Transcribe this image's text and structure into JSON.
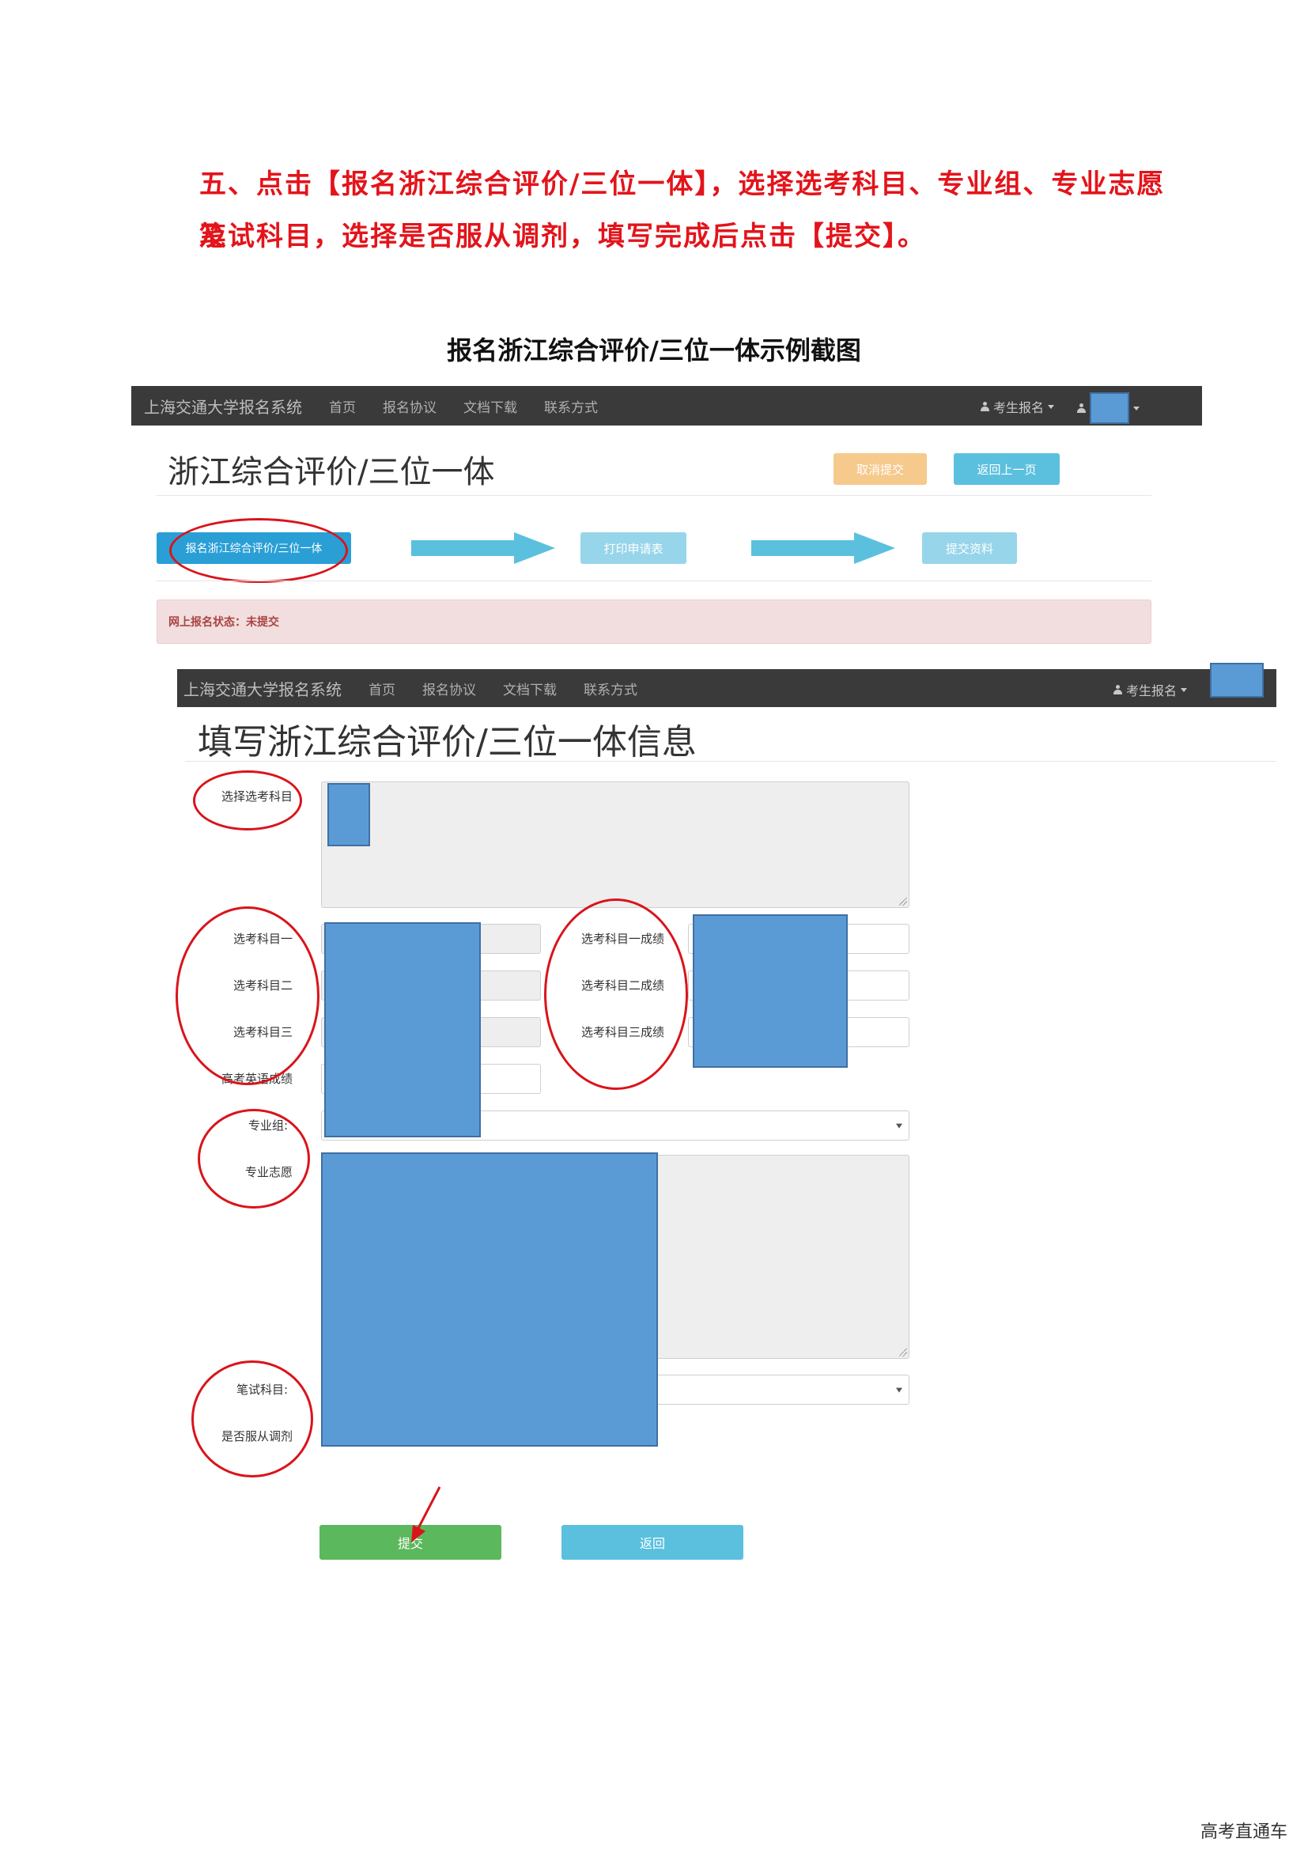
{
  "instructions": {
    "line1": "五、点击【报名浙江综合评价/三位一体】，选择选考科目、专业组、专业志愿及",
    "line2": "笔试科目，选择是否服从调剂，填写完成后点击【提交】。"
  },
  "caption": "报名浙江综合评价/三位一体示例截图",
  "shot1": {
    "nav": {
      "brand": "上海交通大学报名系统",
      "items": [
        "首页",
        "报名协议",
        "文档下载",
        "联系方式"
      ],
      "user_menu": "考生报名"
    },
    "page_title": "浙江综合评价/三位一体",
    "cancel_label": "取消提交",
    "back_label": "返回上一页",
    "steps": [
      "报名浙江综合评价/三位一体",
      "打印申请表",
      "提交资料"
    ],
    "status_text": "网上报名状态：未提交"
  },
  "shot2": {
    "nav": {
      "brand": "上海交通大学报名系统",
      "items": [
        "首页",
        "报名协议",
        "文档下载",
        "联系方式"
      ],
      "user_menu": "考生报名"
    },
    "page_title": "填写浙江综合评价/三位一体信息",
    "labels": {
      "select_subjects": "选择选考科目",
      "subject1": "选考科目一",
      "subject2": "选考科目二",
      "subject3": "选考科目三",
      "english_score": "高考英语成绩",
      "score1": "选考科目一成绩",
      "score2": "选考科目二成绩",
      "score3": "选考科目三成绩",
      "major_group": "专业组:",
      "major_wish": "专业志愿",
      "written_subject": "笔试科目:",
      "accept_adjust": "是否服从调剂"
    },
    "submit_label": "提交",
    "return_label": "返回"
  },
  "watermark": "高考直通车",
  "colors": {
    "instruction_red": "#e3141b",
    "annotation_red": "#d9141b",
    "redaction_blue": "#5b9bd5",
    "primary": "#2a9fd6",
    "info": "#5bc0de",
    "warning": "#f0ad4e",
    "success": "#5cb85c",
    "danger_bg": "#f2dede",
    "danger_text": "#a94442",
    "navbar": "#3a3a3a"
  }
}
